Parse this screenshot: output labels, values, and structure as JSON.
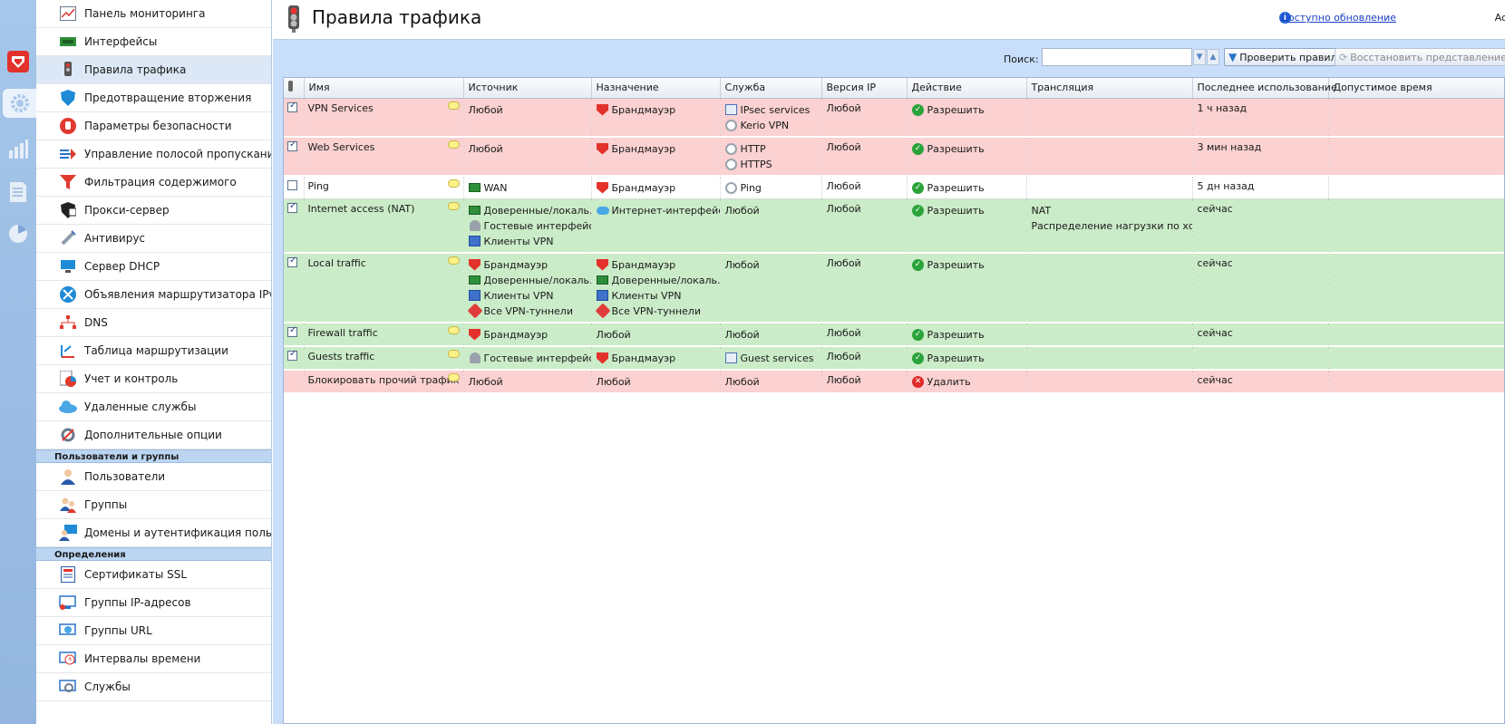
{
  "app": {
    "page_title": "Правила трафика",
    "update_link": "Доступно обновление",
    "user_label": "Ac"
  },
  "sidebar": {
    "items": [
      {
        "label": "Панель мониторинга",
        "icon": "dashboard-icon"
      },
      {
        "label": "Интерфейсы",
        "icon": "interfaces-icon"
      },
      {
        "label": "Правила трафика",
        "icon": "traffic-light-icon",
        "active": true
      },
      {
        "label": "Предотвращение вторжения",
        "icon": "shield-icon"
      },
      {
        "label": "Параметры безопасности",
        "icon": "hand-stop-icon"
      },
      {
        "label": "Управление полосой пропускания и",
        "icon": "bandwidth-icon"
      },
      {
        "label": "Фильтрация содержимого",
        "icon": "filter-icon"
      },
      {
        "label": "Прокси-сервер",
        "icon": "proxy-icon"
      },
      {
        "label": "Антивирус",
        "icon": "antivirus-icon"
      },
      {
        "label": "Сервер DHCP",
        "icon": "dhcp-icon"
      },
      {
        "label": "Объявления маршрутизатора IPv6",
        "icon": "ipv6-icon"
      },
      {
        "label": "DNS",
        "icon": "dns-icon"
      },
      {
        "label": "Таблица маршрутизации",
        "icon": "routing-icon"
      },
      {
        "label": "Учет и контроль",
        "icon": "accounting-icon"
      },
      {
        "label": "Удаленные службы",
        "icon": "cloud-icon"
      },
      {
        "label": "Дополнительные опции",
        "icon": "tools-icon"
      }
    ],
    "section_users": "Пользователи и группы",
    "users_items": [
      {
        "label": "Пользователи",
        "icon": "user-icon"
      },
      {
        "label": "Группы",
        "icon": "group-icon"
      },
      {
        "label": "Домены и аутентификация пользова",
        "icon": "domain-icon"
      }
    ],
    "section_defs": "Определения",
    "defs_items": [
      {
        "label": "Сертификаты SSL",
        "icon": "certificate-icon"
      },
      {
        "label": "Группы IP-адресов",
        "icon": "ip-group-icon"
      },
      {
        "label": "Группы URL",
        "icon": "url-group-icon"
      },
      {
        "label": "Интервалы времени",
        "icon": "clock-icon"
      },
      {
        "label": "Службы",
        "icon": "services-icon"
      }
    ]
  },
  "toolbar": {
    "search_label": "Поиск:",
    "search_value": "",
    "check_rules": "Проверить правила",
    "restore_view": "Восстановить представление"
  },
  "table": {
    "columns": [
      "Имя",
      "Источник",
      "Назначение",
      "Служба",
      "Версия IP",
      "Действие",
      "Трансляция",
      "Последнее использование",
      "Допустимое время"
    ],
    "rows": [
      {
        "kind": "deny",
        "checked": true,
        "name": "VPN Services",
        "source": [
          {
            "icon": "",
            "text": "Любой"
          }
        ],
        "dest": [
          {
            "icon": "firewall",
            "text": "Брандмауэр"
          }
        ],
        "service": [
          {
            "icon": "grp",
            "text": "IPsec services"
          },
          {
            "icon": "svc",
            "text": "Kerio VPN"
          }
        ],
        "ipver": "Любой",
        "action": "Разрешить",
        "action_icon": "ok",
        "translation": [],
        "last_used": "1 ч назад"
      },
      {
        "kind": "deny",
        "checked": true,
        "name": "Web Services",
        "source": [
          {
            "icon": "",
            "text": "Любой"
          }
        ],
        "dest": [
          {
            "icon": "firewall",
            "text": "Брандмауэр"
          }
        ],
        "service": [
          {
            "icon": "svc",
            "text": "HTTP"
          },
          {
            "icon": "svc",
            "text": "HTTPS"
          }
        ],
        "ipver": "Любой",
        "action": "Разрешить",
        "action_icon": "ok",
        "translation": [],
        "last_used": "3 мин назад"
      },
      {
        "kind": "neutral",
        "checked": false,
        "name": "Ping",
        "source": [
          {
            "icon": "net",
            "text": "WAN"
          }
        ],
        "dest": [
          {
            "icon": "firewall",
            "text": "Брандмауэр"
          }
        ],
        "service": [
          {
            "icon": "svc",
            "text": "Ping"
          }
        ],
        "ipver": "Любой",
        "action": "Разрешить",
        "action_icon": "ok",
        "translation": [],
        "last_used": "5 дн назад"
      },
      {
        "kind": "allow",
        "checked": true,
        "name": "Internet access (NAT)",
        "source": [
          {
            "icon": "net",
            "text": "Доверенные/локаль..."
          },
          {
            "icon": "user",
            "text": "Гостевые интерфейсы"
          },
          {
            "icon": "vpn",
            "text": "Клиенты VPN"
          }
        ],
        "dest": [
          {
            "icon": "cloud",
            "text": "Интернет-интерфейсы"
          }
        ],
        "service": [
          {
            "icon": "",
            "text": "Любой"
          }
        ],
        "ipver": "Любой",
        "action": "Разрешить",
        "action_icon": "ok",
        "translation": [
          "NAT",
          "Распределение нагрузки по хостам"
        ],
        "last_used": "сейчас"
      },
      {
        "kind": "allow",
        "checked": true,
        "name": "Local traffic",
        "source": [
          {
            "icon": "firewall",
            "text": "Брандмауэр"
          },
          {
            "icon": "net",
            "text": "Доверенные/локаль..."
          },
          {
            "icon": "vpn",
            "text": "Клиенты VPN"
          },
          {
            "icon": "heart",
            "text": "Все VPN-туннели"
          }
        ],
        "dest": [
          {
            "icon": "firewall",
            "text": "Брандмауэр"
          },
          {
            "icon": "net",
            "text": "Доверенные/локаль..."
          },
          {
            "icon": "vpn",
            "text": "Клиенты VPN"
          },
          {
            "icon": "heart",
            "text": "Все VPN-туннели"
          }
        ],
        "service": [
          {
            "icon": "",
            "text": "Любой"
          }
        ],
        "ipver": "Любой",
        "action": "Разрешить",
        "action_icon": "ok",
        "translation": [],
        "last_used": "сейчас"
      },
      {
        "kind": "allow",
        "checked": true,
        "name": "Firewall traffic",
        "source": [
          {
            "icon": "firewall",
            "text": "Брандмауэр"
          }
        ],
        "dest": [
          {
            "icon": "",
            "text": "Любой"
          }
        ],
        "service": [
          {
            "icon": "",
            "text": "Любой"
          }
        ],
        "ipver": "Любой",
        "action": "Разрешить",
        "action_icon": "ok",
        "translation": [],
        "last_used": "сейчас"
      },
      {
        "kind": "allow",
        "checked": true,
        "name": "Guests traffic",
        "source": [
          {
            "icon": "user",
            "text": "Гостевые интерфейсы"
          }
        ],
        "dest": [
          {
            "icon": "firewall",
            "text": "Брандмауэр"
          }
        ],
        "service": [
          {
            "icon": "grp",
            "text": "Guest services"
          }
        ],
        "ipver": "Любой",
        "action": "Разрешить",
        "action_icon": "ok",
        "translation": [],
        "last_used": ""
      },
      {
        "kind": "deny",
        "checked": null,
        "name": "Блокировать прочий трафик",
        "source": [
          {
            "icon": "",
            "text": "Любой"
          }
        ],
        "dest": [
          {
            "icon": "",
            "text": "Любой"
          }
        ],
        "service": [
          {
            "icon": "",
            "text": "Любой"
          }
        ],
        "ipver": "Любой",
        "action": "Удалить",
        "action_icon": "x",
        "translation": [],
        "last_used": "сейчас"
      }
    ]
  },
  "colors": {
    "deny_row": "#fbd1d1",
    "allow_row": "#cbecc8",
    "main_bg": "#c9defb",
    "accent": "#1a3fc7"
  }
}
